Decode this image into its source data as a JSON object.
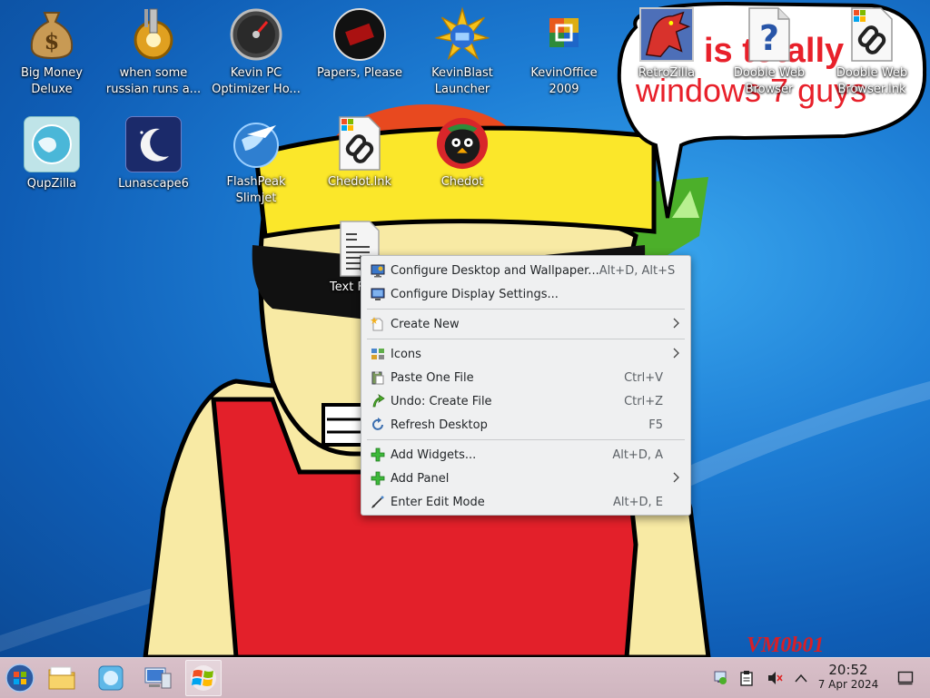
{
  "desktop": {
    "icons": [
      {
        "label": "Big Money Deluxe",
        "icon": "money-bag-icon"
      },
      {
        "label": "when some russian runs a...",
        "icon": "gear-icon"
      },
      {
        "label": "Kevin PC Optimizer Ho...",
        "icon": "speedometer-icon"
      },
      {
        "label": "Papers, Please",
        "icon": "papers-please-icon"
      },
      {
        "label": "KevinBlast Launcher",
        "icon": "burst-icon"
      },
      {
        "label": "KevinOffice 2009",
        "icon": "office-icon"
      },
      {
        "label": "RetroZilla",
        "icon": "dragon-icon"
      },
      {
        "label": "Dooble Web Browser",
        "icon": "question-doc-icon"
      },
      {
        "label": "Dooble Web Browser.lnk",
        "icon": "link-doc-icon"
      },
      {
        "label": "QupZilla",
        "icon": "globe-icon"
      },
      {
        "label": "Lunascape6",
        "icon": "moon-icon"
      },
      {
        "label": "FlashPeak Slimjet",
        "icon": "jet-globe-icon"
      },
      {
        "label": "Chedot.lnk",
        "icon": "link-doc-icon"
      },
      {
        "label": "Chedot",
        "icon": "penguin-icon"
      },
      {
        "label": "Text F",
        "icon": "text-file-icon"
      }
    ]
  },
  "wallpaper": {
    "speech_bubble_line1": "is totally",
    "speech_bubble_line2": "windows 7 guys",
    "signature": "VM0b01"
  },
  "context_menu": {
    "items": [
      {
        "label": "Configure Desktop and Wallpaper...",
        "shortcut": "Alt+D, Alt+S",
        "icon": "desktop-settings-icon",
        "submenu": false
      },
      {
        "label": "Configure Display Settings...",
        "shortcut": "",
        "icon": "display-icon",
        "submenu": false
      },
      {
        "label": "Create New",
        "shortcut": "",
        "icon": "new-item-icon",
        "submenu": true
      },
      {
        "label": "Icons",
        "shortcut": "",
        "icon": "icons-grid-icon",
        "submenu": true
      },
      {
        "label": "Paste One File",
        "shortcut": "Ctrl+V",
        "icon": "paste-icon",
        "submenu": false
      },
      {
        "label": "Undo: Create File",
        "shortcut": "Ctrl+Z",
        "icon": "undo-icon",
        "submenu": false
      },
      {
        "label": "Refresh Desktop",
        "shortcut": "F5",
        "icon": "refresh-icon",
        "submenu": false
      },
      {
        "label": "Add Widgets...",
        "shortcut": "Alt+D, A",
        "icon": "plus-icon",
        "submenu": false
      },
      {
        "label": "Add Panel",
        "shortcut": "",
        "icon": "plus-icon",
        "submenu": true
      },
      {
        "label": "Enter Edit Mode",
        "shortcut": "Alt+D, E",
        "icon": "edit-mode-icon",
        "submenu": false
      }
    ]
  },
  "taskbar": {
    "time": "20:52",
    "date": "7 Apr 2024"
  },
  "colors": {
    "desktop_blue": "#1e7fd6",
    "taskbar_pink": "#d4bac4",
    "menu_bg": "#eff0f1",
    "bubble_text_red": "#e8202a"
  }
}
